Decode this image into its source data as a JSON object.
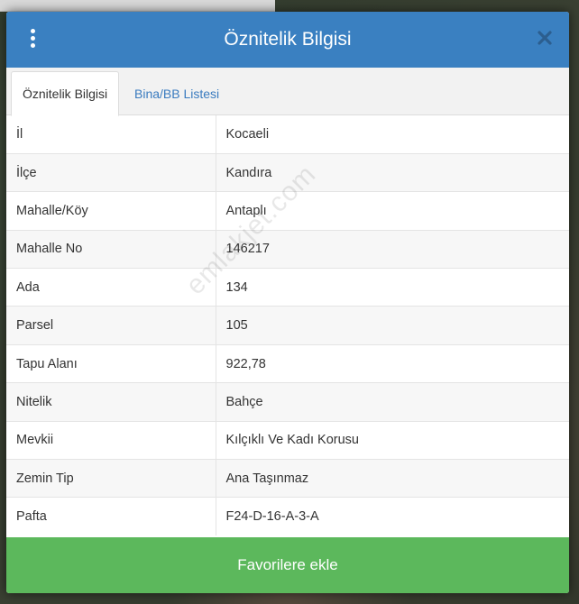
{
  "header": {
    "title": "Öznitelik Bilgisi",
    "menu_icon": "vertical-ellipsis-icon",
    "close_icon": "close-icon"
  },
  "tabs": [
    {
      "label": "Öznitelik Bilgisi",
      "active": true
    },
    {
      "label": "Bina/BB Listesi",
      "active": false
    }
  ],
  "attributes": [
    {
      "key": "İl",
      "value": "Kocaeli"
    },
    {
      "key": "İlçe",
      "value": "Kandıra"
    },
    {
      "key": "Mahalle/Köy",
      "value": "Antaplı"
    },
    {
      "key": "Mahalle No",
      "value": "146217"
    },
    {
      "key": "Ada",
      "value": "134"
    },
    {
      "key": "Parsel",
      "value": "105"
    },
    {
      "key": "Tapu Alanı",
      "value": "922,78"
    },
    {
      "key": "Nitelik",
      "value": "Bahçe"
    },
    {
      "key": "Mevkii",
      "value": "Kılçıklı Ve Kadı Korusu"
    },
    {
      "key": "Zemin Tip",
      "value": "Ana Taşınmaz"
    },
    {
      "key": "Pafta",
      "value": "F24-D-16-A-3-A"
    }
  ],
  "footer": {
    "button_label": "Favorilere ekle"
  },
  "watermark": "emlakjet.com",
  "colors": {
    "header": "#3a80c1",
    "tab_link": "#3a7bbf",
    "footer_button": "#5cb85c"
  }
}
